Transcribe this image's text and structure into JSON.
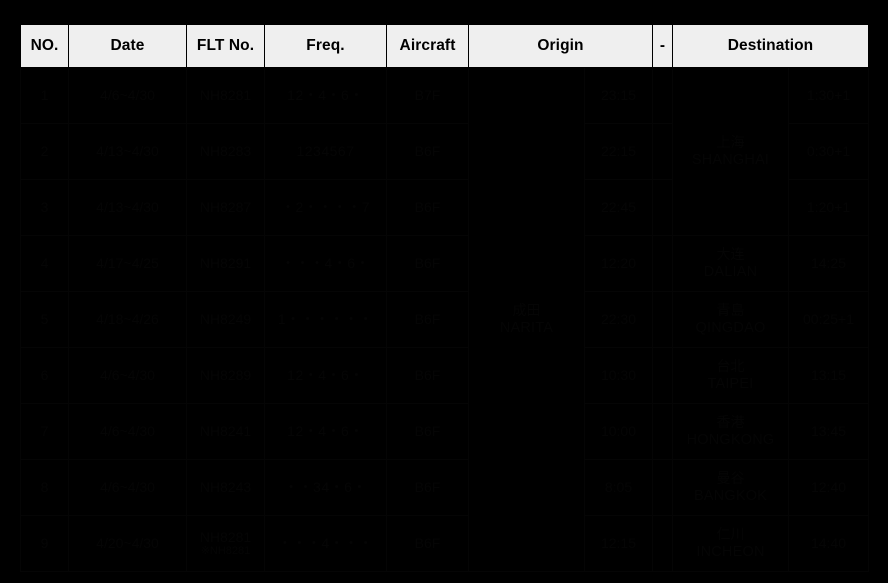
{
  "table": {
    "columns": [
      {
        "key": "no",
        "label": "NO."
      },
      {
        "key": "date",
        "label": "Date"
      },
      {
        "key": "flt",
        "label": "FLT No."
      },
      {
        "key": "freq",
        "label": "Freq."
      },
      {
        "key": "aircraft",
        "label": "Aircraft"
      },
      {
        "key": "origin",
        "label": "Origin"
      },
      {
        "key": "dash",
        "label": "-"
      },
      {
        "key": "dest",
        "label": "Destination"
      }
    ],
    "origin_merged": {
      "jp": "成田",
      "en": "NARITA"
    },
    "colors": {
      "header_bg": "#efefef",
      "page_bg": "#000000",
      "highlight_bg": "#dce9f5",
      "alert_text": "#ff0000",
      "body_text": "#050505"
    },
    "rows": [
      {
        "no": "1",
        "date": "4/6~4/30",
        "date_alert": false,
        "flt": "NH8281",
        "freq": "12・4・6・",
        "aircraft": "B7F",
        "aircraft_highlight": true,
        "dep_time": "23:15",
        "dest_jp": "",
        "dest_en": "",
        "dest_merged": true,
        "arr_time": "1:30+1"
      },
      {
        "no": "2",
        "date": "4/13~4/30",
        "date_alert": false,
        "flt": "NH8283",
        "freq": "1234567",
        "aircraft": "B6F",
        "aircraft_highlight": false,
        "dep_time": "22:15",
        "dest_jp": "上海",
        "dest_en": "SHANGHAI",
        "dest_merged": false,
        "arr_time": "0:30+1"
      },
      {
        "no": "3",
        "date": "4/13~4/30",
        "date_alert": false,
        "flt": "NH8287",
        "freq": "・2・・・・7",
        "aircraft": "B6F",
        "aircraft_highlight": false,
        "dep_time": "22:45",
        "dest_jp": "",
        "dest_en": "",
        "dest_merged": true,
        "arr_time": "1:20+1"
      },
      {
        "no": "4",
        "date": "4/17~4/25",
        "date_alert": true,
        "flt": "NH8291",
        "freq": "・・・4・6・",
        "aircraft": "B6F",
        "aircraft_highlight": false,
        "dep_time": "12:20",
        "dest_jp": "大连",
        "dest_en": "DALIAN",
        "dest_merged": false,
        "arr_time": "14:25"
      },
      {
        "no": "5",
        "date": "4/18~4/26",
        "date_alert": false,
        "flt": "NH8249",
        "freq": "1・・・・・・",
        "aircraft": "B6F",
        "aircraft_highlight": false,
        "dep_time": "22:30",
        "dest_jp": "青島",
        "dest_en": "QINGDAO",
        "dest_merged": false,
        "arr_time": "00:25+1"
      },
      {
        "no": "6",
        "date": "4/6~4/30",
        "date_alert": false,
        "flt": "NH8289",
        "freq": "12・4・6・",
        "aircraft": "B6F",
        "aircraft_highlight": false,
        "dep_time": "10:30",
        "dest_jp": "台北",
        "dest_en": "TAIPEI",
        "dest_merged": false,
        "arr_time": "13:15"
      },
      {
        "no": "7",
        "date": "4/6~4/30",
        "date_alert": false,
        "flt": "NH8241",
        "freq": "12・4・6・",
        "aircraft": "B6F",
        "aircraft_highlight": false,
        "dep_time": "10:00",
        "dest_jp": "香港",
        "dest_en": "HONGKONG",
        "dest_merged": false,
        "arr_time": "13:45"
      },
      {
        "no": "8",
        "date": "4/6~4/30",
        "date_alert": false,
        "flt": "NH8243",
        "freq": "・・34・6・",
        "aircraft": "B6F",
        "aircraft_highlight": false,
        "dep_time": "8:05",
        "dest_jp": "曼谷",
        "dest_en": "BANGKOK",
        "dest_merged": false,
        "arr_time": "12:40"
      },
      {
        "no": "9",
        "date": "4/20~4/30",
        "date_alert": false,
        "flt": "NH8281",
        "flt_note": "※NH8281",
        "freq": "・・・4・・・",
        "aircraft": "B6F",
        "aircraft_highlight": false,
        "dep_time": "12:15",
        "dest_jp": "仁川",
        "dest_en": "INCHEON",
        "dest_merged": false,
        "arr_time": "14:40"
      }
    ]
  }
}
